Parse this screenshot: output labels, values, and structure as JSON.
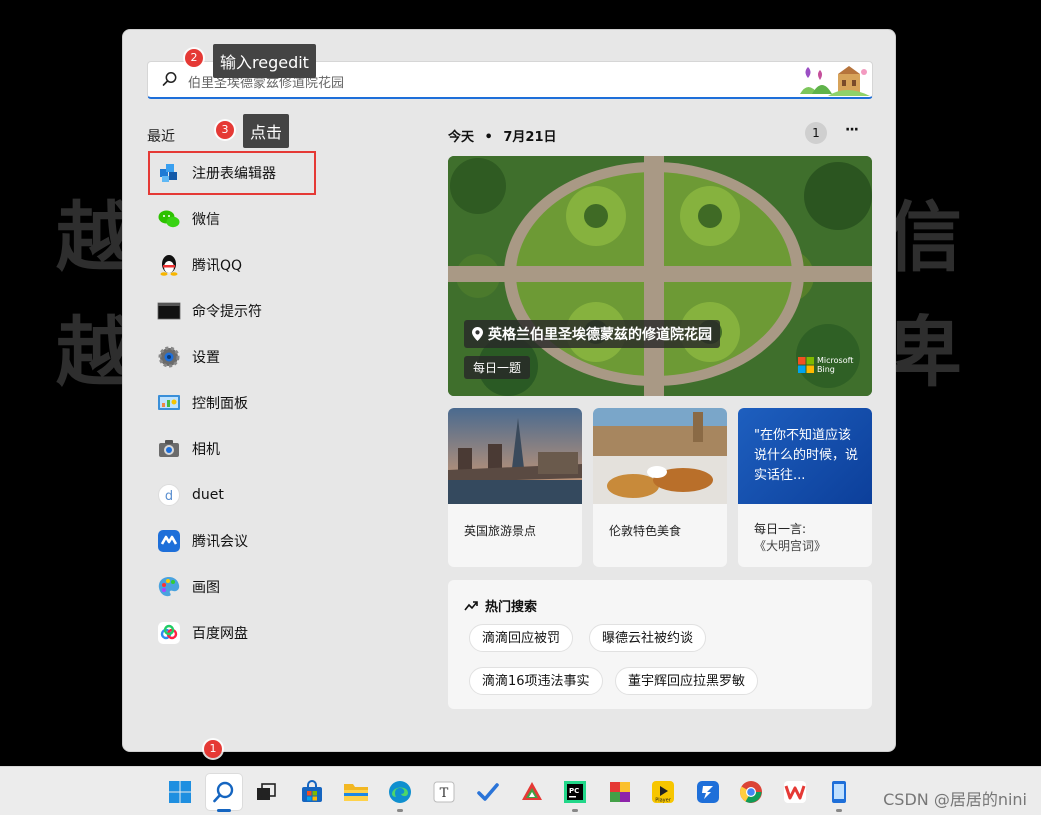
{
  "background": {
    "line1_left": "越",
    "line1_right": "信",
    "line2_left": "越",
    "line2_right": "卑"
  },
  "search": {
    "placeholder": "伯里圣埃德蒙兹修道院花园"
  },
  "annotations": {
    "step1_num": "1",
    "step2_num": "2",
    "step2_text": "输入regedit",
    "step3_num": "3",
    "step3_text": "点击"
  },
  "recent": {
    "title": "最近",
    "items": [
      {
        "label": "注册表编辑器",
        "icon": "registry-editor-icon"
      },
      {
        "label": "微信",
        "icon": "wechat-icon"
      },
      {
        "label": "腾讯QQ",
        "icon": "qq-penguin-icon"
      },
      {
        "label": "命令提示符",
        "icon": "command-prompt-icon"
      },
      {
        "label": "设置",
        "icon": "settings-gear-icon"
      },
      {
        "label": "控制面板",
        "icon": "control-panel-icon"
      },
      {
        "label": "相机",
        "icon": "camera-icon"
      },
      {
        "label": "duet",
        "icon": "duet-icon"
      },
      {
        "label": "腾讯会议",
        "icon": "tencent-meeting-icon"
      },
      {
        "label": "画图",
        "icon": "paint-palette-icon"
      },
      {
        "label": "百度网盘",
        "icon": "baidu-netdisk-icon"
      }
    ]
  },
  "today": {
    "label": "今天",
    "separator": "•",
    "date": "7月21日",
    "count": "1",
    "more": "···"
  },
  "hero": {
    "location": "英格兰伯里圣埃德蒙兹的修道院花园",
    "tag": "每日一题",
    "brand_line1": "Microsoft",
    "brand_line2": "Bing"
  },
  "news": [
    {
      "label": "英国旅游景点"
    },
    {
      "label": "伦敦特色美食"
    },
    {
      "quote": "\"在你不知道应该说什么的时候，说实话往...",
      "label_line1": "每日一言:",
      "label_line2": "《大明宫词》"
    }
  ],
  "trending": {
    "title": "热门搜索",
    "items": [
      "滴滴回应被罚",
      "曝德云社被约谈",
      "滴滴16项违法事实",
      "董宇辉回应拉黑罗敏"
    ]
  },
  "watermark": "CSDN @居居的nini",
  "colors": {
    "accent": "#1e6fd9",
    "badge": "#e53935",
    "highlight": "#e53935"
  },
  "taskbar_icons": [
    "windows-start-icon",
    "search-icon",
    "task-view-icon",
    "store-icon",
    "file-explorer-icon",
    "edge-icon",
    "typora-icon",
    "todo-icon",
    "app-icon",
    "pycharm-icon",
    "office-tool-icon",
    "video-player-icon",
    "dingtalk-icon",
    "chrome-icon",
    "wps-icon",
    "phone-link-icon"
  ]
}
